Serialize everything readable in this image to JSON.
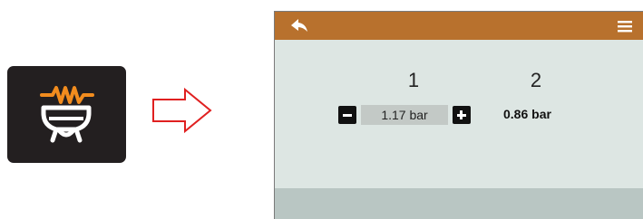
{
  "screen": {
    "columns": [
      {
        "number": "1",
        "value": "1.17 bar"
      },
      {
        "number": "2",
        "value": "0.86 bar"
      }
    ]
  },
  "colors": {
    "topbar": "#b8712d",
    "accent_heater": "#f28c1e",
    "arrow_outline": "#e02020",
    "screen_bg": "#dde6e3",
    "bottom_band": "#b9c6c3"
  },
  "icons": {
    "key": "boiler-heater-icon",
    "arrow": "arrow-right-icon",
    "back": "back-icon",
    "menu": "menu-icon"
  }
}
